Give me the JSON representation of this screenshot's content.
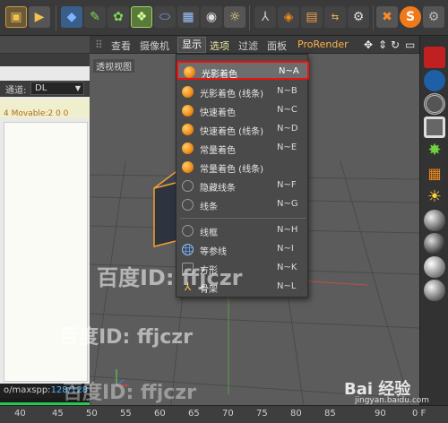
{
  "viewport": {
    "menus": [
      "查看",
      "摄像机",
      "显示",
      "选项",
      "过滤",
      "面板",
      "ProRender"
    ],
    "active_menu": "显示",
    "label": "透视视图"
  },
  "left_panel": {
    "channel_label": "通道:",
    "channel_value": "DL",
    "info_text": "4 Movable:2  0 0",
    "status_prefix": "o/maxspp:",
    "status_value": "128/128",
    "progress": 1.0
  },
  "display_menu": {
    "items": [
      {
        "label": "光影着色",
        "shortcut": "N~A",
        "icon": "orange-sphere-icon",
        "highlighted": true
      },
      {
        "label": "光影着色 (线条)",
        "shortcut": "N~B",
        "icon": "orange-sphere-icon"
      },
      {
        "label": "快速着色",
        "shortcut": "N~C",
        "icon": "orange-sphere-icon"
      },
      {
        "label": "快速着色 (线条)",
        "shortcut": "N~D",
        "icon": "orange-sphere-icon"
      },
      {
        "label": "常量着色",
        "shortcut": "N~E",
        "icon": "orange-sphere-icon"
      },
      {
        "label": "常量着色 (线条)",
        "shortcut": "",
        "icon": "orange-sphere-icon"
      },
      {
        "label": "隐藏线条",
        "shortcut": "N~F",
        "icon": "wire-sphere-icon"
      },
      {
        "label": "线条",
        "shortcut": "N~G",
        "icon": "wire-sphere-icon"
      },
      {
        "label": "线框",
        "shortcut": "N~H",
        "icon": "wire-sphere-icon"
      },
      {
        "label": "等参线",
        "shortcut": "N~I",
        "icon": "isoparm-icon"
      },
      {
        "label": "方形",
        "shortcut": "N~K",
        "icon": "box-icon"
      },
      {
        "label": "骨架",
        "shortcut": "N~L",
        "icon": "skeleton-icon"
      }
    ]
  },
  "ruler": {
    "ticks": [
      "40",
      "45",
      "50",
      "55",
      "60",
      "65",
      "70",
      "75",
      "80",
      "85",
      "90",
      "0 F"
    ]
  },
  "watermarks": [
    "百度ID: ffjczr",
    "百度ID: ffjczr",
    "百度ID: ffjczr"
  ],
  "brand": {
    "text": "Bai 经验",
    "url": "jingyan.baidu.com"
  },
  "colors": {
    "highlight_border": "#e11111",
    "accent_orange": "#f08a1a",
    "progress": "#28c653",
    "status_value": "#4fb7ff"
  }
}
